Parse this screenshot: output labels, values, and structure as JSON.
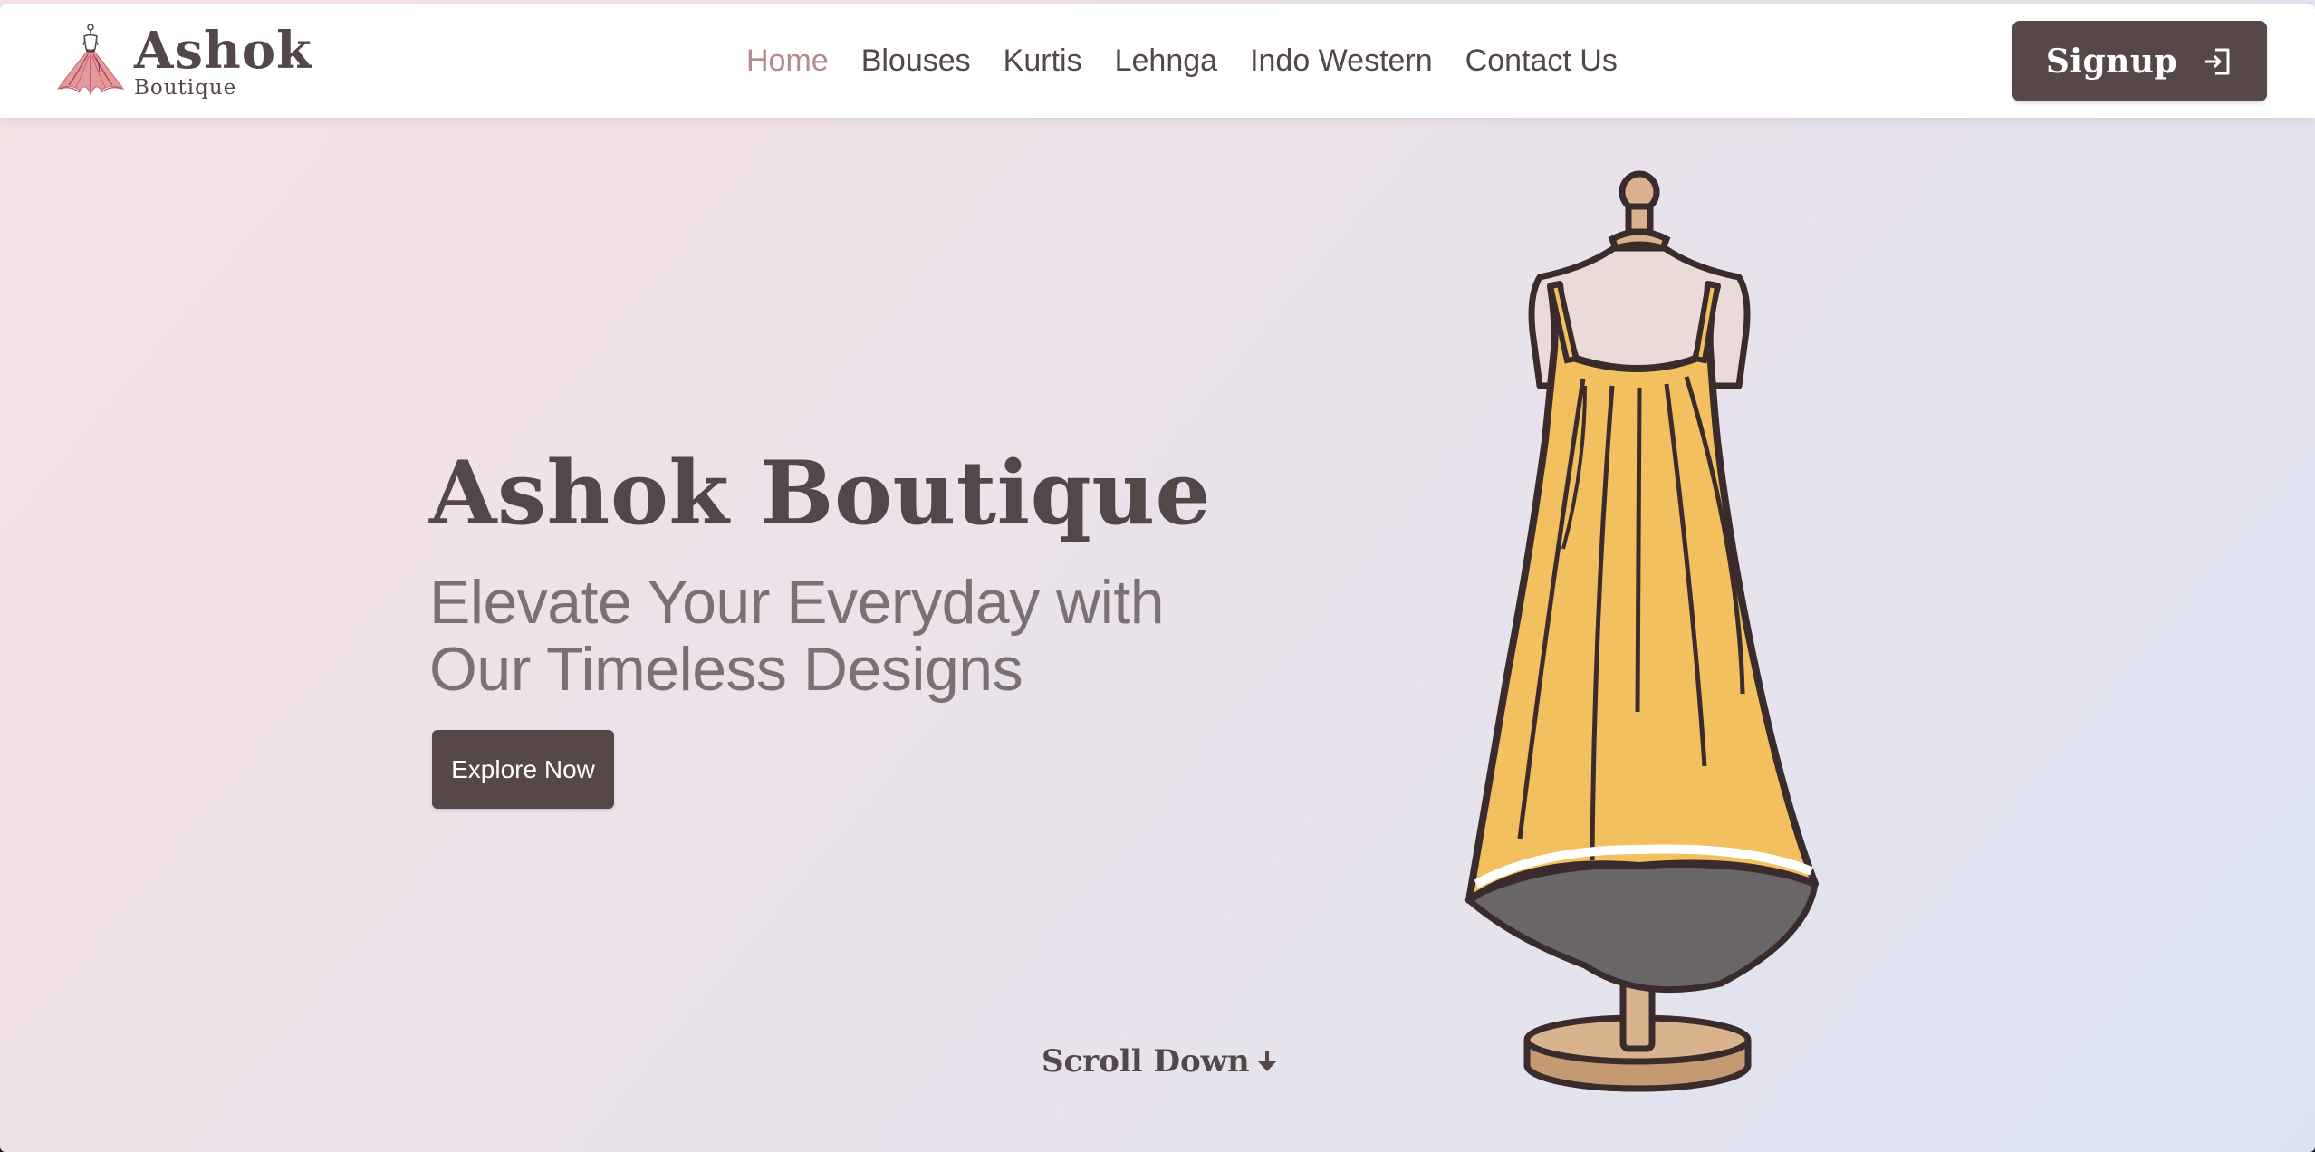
{
  "brand": {
    "name": "Ashok",
    "subtitle": "Boutique",
    "logo_icon": "dress-logo-icon"
  },
  "nav": {
    "links": [
      {
        "label": "Home",
        "active": true
      },
      {
        "label": "Blouses",
        "active": false
      },
      {
        "label": "Kurtis",
        "active": false
      },
      {
        "label": "Lehnga",
        "active": false
      },
      {
        "label": "Indo Western",
        "active": false
      },
      {
        "label": "Contact Us",
        "active": false
      }
    ],
    "signup": {
      "label": "Signup",
      "icon": "sign-in-icon"
    }
  },
  "hero": {
    "title": "Ashok Boutique",
    "subtitle": "Elevate Your Everyday with Our Timeless Designs",
    "cta_label": "Explore Now",
    "scroll_label": "Scroll Down",
    "scroll_icon": "arrow-down-icon",
    "illustration": "dress-on-mannequin-image"
  },
  "colors": {
    "primary": "#564749",
    "active_link": "#b38b8e",
    "dress_yellow": "#f2c05f",
    "background_start": "#f6e2e5",
    "background_end": "#dbe3f3"
  }
}
